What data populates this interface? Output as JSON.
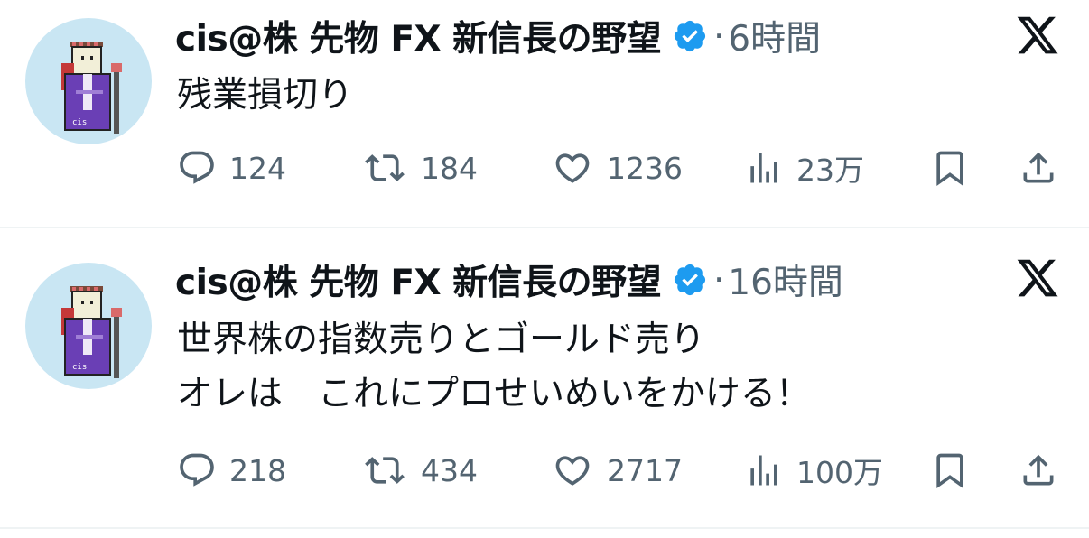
{
  "tweets": [
    {
      "display_name": "cis@株 先物 FX 新信長の野望",
      "time": "6時間",
      "separator": "·",
      "text_lines": [
        "残業損切り"
      ],
      "replies": "124",
      "retweets": "184",
      "likes": "1236",
      "views": "23万"
    },
    {
      "display_name": "cis@株 先物 FX 新信長の野望",
      "time": "16時間",
      "separator": "·",
      "text_lines": [
        "世界株の指数売りとゴールド売り",
        "オレは　これにプロせいめいをかける！"
      ],
      "replies": "218",
      "retweets": "434",
      "likes": "2717",
      "views": "100万"
    }
  ],
  "icons": {
    "reply": "reply-icon",
    "retweet": "retweet-icon",
    "like": "heart-icon",
    "views": "views-chart-icon",
    "bookmark": "bookmark-icon",
    "share": "share-icon",
    "verified": "verified-badge-icon",
    "brand": "x-logo-icon"
  },
  "colors": {
    "text_primary": "#0f1419",
    "text_secondary": "#536471",
    "verified_blue": "#1d9bf0",
    "avatar_bg": "#c9e6f3",
    "divider": "#eff3f4"
  }
}
